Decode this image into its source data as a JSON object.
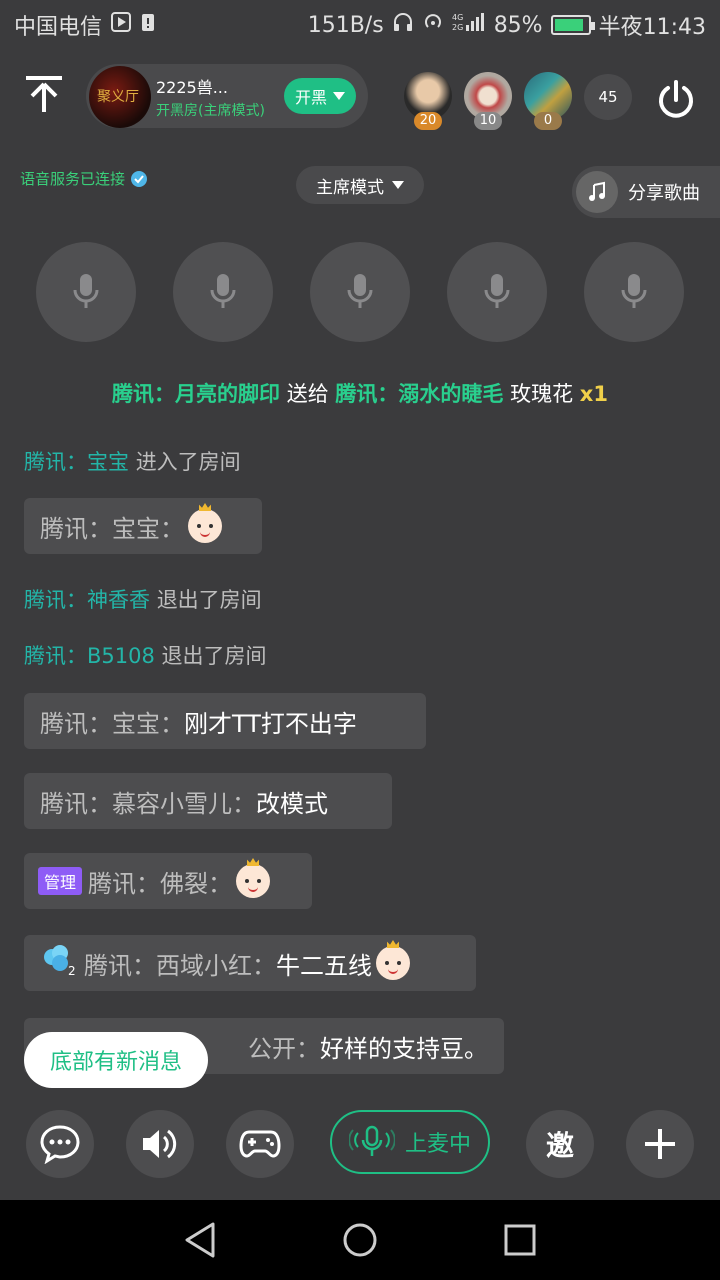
{
  "status": {
    "carrier": "中国电信",
    "speed": "151B/s",
    "network": "4G 2G",
    "battery": "85%",
    "time": "半夜11:43"
  },
  "header": {
    "room_name": "2225兽...",
    "room_mode": "开黑房(主席模式)",
    "kaihei_label": "开黑",
    "avatar_text": "聚义厅",
    "top_users": [
      {
        "rank": "20",
        "badge_color": "#d9892a"
      },
      {
        "rank": "10",
        "badge_color": "#888888"
      },
      {
        "rank": "0",
        "badge_color": "#9a7a4a"
      }
    ],
    "audience_count": "45"
  },
  "voice": {
    "status": "语音服务已连接",
    "mode": "主席模式",
    "share_song": "分享歌曲"
  },
  "gift": {
    "sender": "腾讯：月亮的脚印",
    "verb": "送给",
    "receiver": "腾讯：溺水的睫毛",
    "item": "玫瑰花",
    "qty": "x1"
  },
  "messages": {
    "sys1": {
      "prefix": "腾讯：",
      "name": "宝宝",
      "action": "进入了房间"
    },
    "chat1": {
      "sender": "腾讯：宝宝："
    },
    "sys2": {
      "prefix": "腾讯：",
      "name": "神香香",
      "action": "退出了房间"
    },
    "sys3": {
      "prefix": "腾讯：",
      "name": "B5108",
      "action": "退出了房间"
    },
    "chat2": {
      "sender": "腾讯：宝宝：",
      "text": "刚才TT打不出字"
    },
    "chat3": {
      "sender": "腾讯：慕容小雪儿：",
      "text": "改模式"
    },
    "chat4": {
      "tag": "管理",
      "sender": "腾讯：佛裂："
    },
    "chat5": {
      "sender": "腾讯：西域小红：",
      "text": "牛二五线"
    },
    "chat6": {
      "sender": "公开：",
      "text": "好样的支持豆。"
    }
  },
  "new_msg": "底部有新消息",
  "toolbar": {
    "onmic_label": "上麦中",
    "invite_label": "邀"
  },
  "colors": {
    "accent_green": "#1fbf85",
    "background": "#3b3b3d"
  }
}
